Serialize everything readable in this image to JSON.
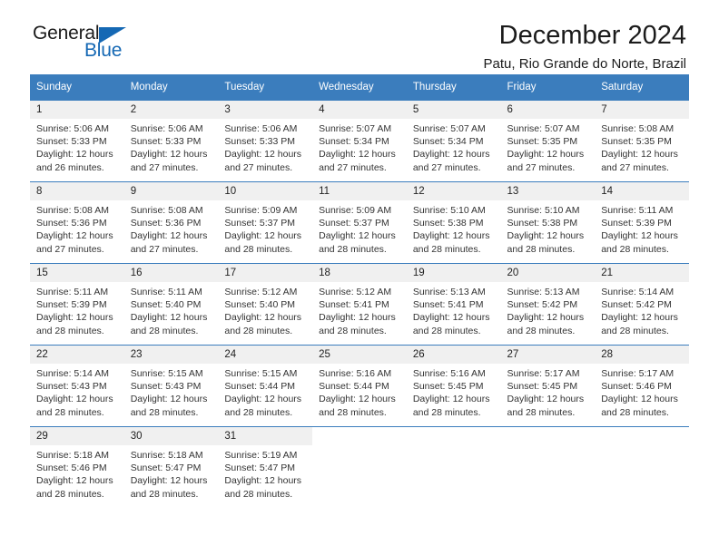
{
  "logo": {
    "word1": "General",
    "word2": "Blue",
    "triangle_color": "#1568b4"
  },
  "header": {
    "title": "December 2024",
    "subtitle": "Patu, Rio Grande do Norte, Brazil"
  },
  "theme": {
    "header_blue": "#3b7dbd",
    "daynum_bg": "#f0f0f0",
    "text": "#222222"
  },
  "calendar": {
    "weekday_headers": [
      "Sunday",
      "Monday",
      "Tuesday",
      "Wednesday",
      "Thursday",
      "Friday",
      "Saturday"
    ],
    "labels": {
      "sunrise": "Sunrise:",
      "sunset": "Sunset:",
      "daylight": "Daylight:"
    },
    "weeks": [
      [
        {
          "day": "1",
          "sunrise": "Sunrise: 5:06 AM",
          "sunset": "Sunset: 5:33 PM",
          "daylight1": "Daylight: 12 hours",
          "daylight2": "and 26 minutes."
        },
        {
          "day": "2",
          "sunrise": "Sunrise: 5:06 AM",
          "sunset": "Sunset: 5:33 PM",
          "daylight1": "Daylight: 12 hours",
          "daylight2": "and 27 minutes."
        },
        {
          "day": "3",
          "sunrise": "Sunrise: 5:06 AM",
          "sunset": "Sunset: 5:33 PM",
          "daylight1": "Daylight: 12 hours",
          "daylight2": "and 27 minutes."
        },
        {
          "day": "4",
          "sunrise": "Sunrise: 5:07 AM",
          "sunset": "Sunset: 5:34 PM",
          "daylight1": "Daylight: 12 hours",
          "daylight2": "and 27 minutes."
        },
        {
          "day": "5",
          "sunrise": "Sunrise: 5:07 AM",
          "sunset": "Sunset: 5:34 PM",
          "daylight1": "Daylight: 12 hours",
          "daylight2": "and 27 minutes."
        },
        {
          "day": "6",
          "sunrise": "Sunrise: 5:07 AM",
          "sunset": "Sunset: 5:35 PM",
          "daylight1": "Daylight: 12 hours",
          "daylight2": "and 27 minutes."
        },
        {
          "day": "7",
          "sunrise": "Sunrise: 5:08 AM",
          "sunset": "Sunset: 5:35 PM",
          "daylight1": "Daylight: 12 hours",
          "daylight2": "and 27 minutes."
        }
      ],
      [
        {
          "day": "8",
          "sunrise": "Sunrise: 5:08 AM",
          "sunset": "Sunset: 5:36 PM",
          "daylight1": "Daylight: 12 hours",
          "daylight2": "and 27 minutes."
        },
        {
          "day": "9",
          "sunrise": "Sunrise: 5:08 AM",
          "sunset": "Sunset: 5:36 PM",
          "daylight1": "Daylight: 12 hours",
          "daylight2": "and 27 minutes."
        },
        {
          "day": "10",
          "sunrise": "Sunrise: 5:09 AM",
          "sunset": "Sunset: 5:37 PM",
          "daylight1": "Daylight: 12 hours",
          "daylight2": "and 28 minutes."
        },
        {
          "day": "11",
          "sunrise": "Sunrise: 5:09 AM",
          "sunset": "Sunset: 5:37 PM",
          "daylight1": "Daylight: 12 hours",
          "daylight2": "and 28 minutes."
        },
        {
          "day": "12",
          "sunrise": "Sunrise: 5:10 AM",
          "sunset": "Sunset: 5:38 PM",
          "daylight1": "Daylight: 12 hours",
          "daylight2": "and 28 minutes."
        },
        {
          "day": "13",
          "sunrise": "Sunrise: 5:10 AM",
          "sunset": "Sunset: 5:38 PM",
          "daylight1": "Daylight: 12 hours",
          "daylight2": "and 28 minutes."
        },
        {
          "day": "14",
          "sunrise": "Sunrise: 5:11 AM",
          "sunset": "Sunset: 5:39 PM",
          "daylight1": "Daylight: 12 hours",
          "daylight2": "and 28 minutes."
        }
      ],
      [
        {
          "day": "15",
          "sunrise": "Sunrise: 5:11 AM",
          "sunset": "Sunset: 5:39 PM",
          "daylight1": "Daylight: 12 hours",
          "daylight2": "and 28 minutes."
        },
        {
          "day": "16",
          "sunrise": "Sunrise: 5:11 AM",
          "sunset": "Sunset: 5:40 PM",
          "daylight1": "Daylight: 12 hours",
          "daylight2": "and 28 minutes."
        },
        {
          "day": "17",
          "sunrise": "Sunrise: 5:12 AM",
          "sunset": "Sunset: 5:40 PM",
          "daylight1": "Daylight: 12 hours",
          "daylight2": "and 28 minutes."
        },
        {
          "day": "18",
          "sunrise": "Sunrise: 5:12 AM",
          "sunset": "Sunset: 5:41 PM",
          "daylight1": "Daylight: 12 hours",
          "daylight2": "and 28 minutes."
        },
        {
          "day": "19",
          "sunrise": "Sunrise: 5:13 AM",
          "sunset": "Sunset: 5:41 PM",
          "daylight1": "Daylight: 12 hours",
          "daylight2": "and 28 minutes."
        },
        {
          "day": "20",
          "sunrise": "Sunrise: 5:13 AM",
          "sunset": "Sunset: 5:42 PM",
          "daylight1": "Daylight: 12 hours",
          "daylight2": "and 28 minutes."
        },
        {
          "day": "21",
          "sunrise": "Sunrise: 5:14 AM",
          "sunset": "Sunset: 5:42 PM",
          "daylight1": "Daylight: 12 hours",
          "daylight2": "and 28 minutes."
        }
      ],
      [
        {
          "day": "22",
          "sunrise": "Sunrise: 5:14 AM",
          "sunset": "Sunset: 5:43 PM",
          "daylight1": "Daylight: 12 hours",
          "daylight2": "and 28 minutes."
        },
        {
          "day": "23",
          "sunrise": "Sunrise: 5:15 AM",
          "sunset": "Sunset: 5:43 PM",
          "daylight1": "Daylight: 12 hours",
          "daylight2": "and 28 minutes."
        },
        {
          "day": "24",
          "sunrise": "Sunrise: 5:15 AM",
          "sunset": "Sunset: 5:44 PM",
          "daylight1": "Daylight: 12 hours",
          "daylight2": "and 28 minutes."
        },
        {
          "day": "25",
          "sunrise": "Sunrise: 5:16 AM",
          "sunset": "Sunset: 5:44 PM",
          "daylight1": "Daylight: 12 hours",
          "daylight2": "and 28 minutes."
        },
        {
          "day": "26",
          "sunrise": "Sunrise: 5:16 AM",
          "sunset": "Sunset: 5:45 PM",
          "daylight1": "Daylight: 12 hours",
          "daylight2": "and 28 minutes."
        },
        {
          "day": "27",
          "sunrise": "Sunrise: 5:17 AM",
          "sunset": "Sunset: 5:45 PM",
          "daylight1": "Daylight: 12 hours",
          "daylight2": "and 28 minutes."
        },
        {
          "day": "28",
          "sunrise": "Sunrise: 5:17 AM",
          "sunset": "Sunset: 5:46 PM",
          "daylight1": "Daylight: 12 hours",
          "daylight2": "and 28 minutes."
        }
      ],
      [
        {
          "day": "29",
          "sunrise": "Sunrise: 5:18 AM",
          "sunset": "Sunset: 5:46 PM",
          "daylight1": "Daylight: 12 hours",
          "daylight2": "and 28 minutes."
        },
        {
          "day": "30",
          "sunrise": "Sunrise: 5:18 AM",
          "sunset": "Sunset: 5:47 PM",
          "daylight1": "Daylight: 12 hours",
          "daylight2": "and 28 minutes."
        },
        {
          "day": "31",
          "sunrise": "Sunrise: 5:19 AM",
          "sunset": "Sunset: 5:47 PM",
          "daylight1": "Daylight: 12 hours",
          "daylight2": "and 28 minutes."
        },
        {
          "day": "",
          "sunrise": "",
          "sunset": "",
          "daylight1": "",
          "daylight2": ""
        },
        {
          "day": "",
          "sunrise": "",
          "sunset": "",
          "daylight1": "",
          "daylight2": ""
        },
        {
          "day": "",
          "sunrise": "",
          "sunset": "",
          "daylight1": "",
          "daylight2": ""
        },
        {
          "day": "",
          "sunrise": "",
          "sunset": "",
          "daylight1": "",
          "daylight2": ""
        }
      ]
    ]
  }
}
